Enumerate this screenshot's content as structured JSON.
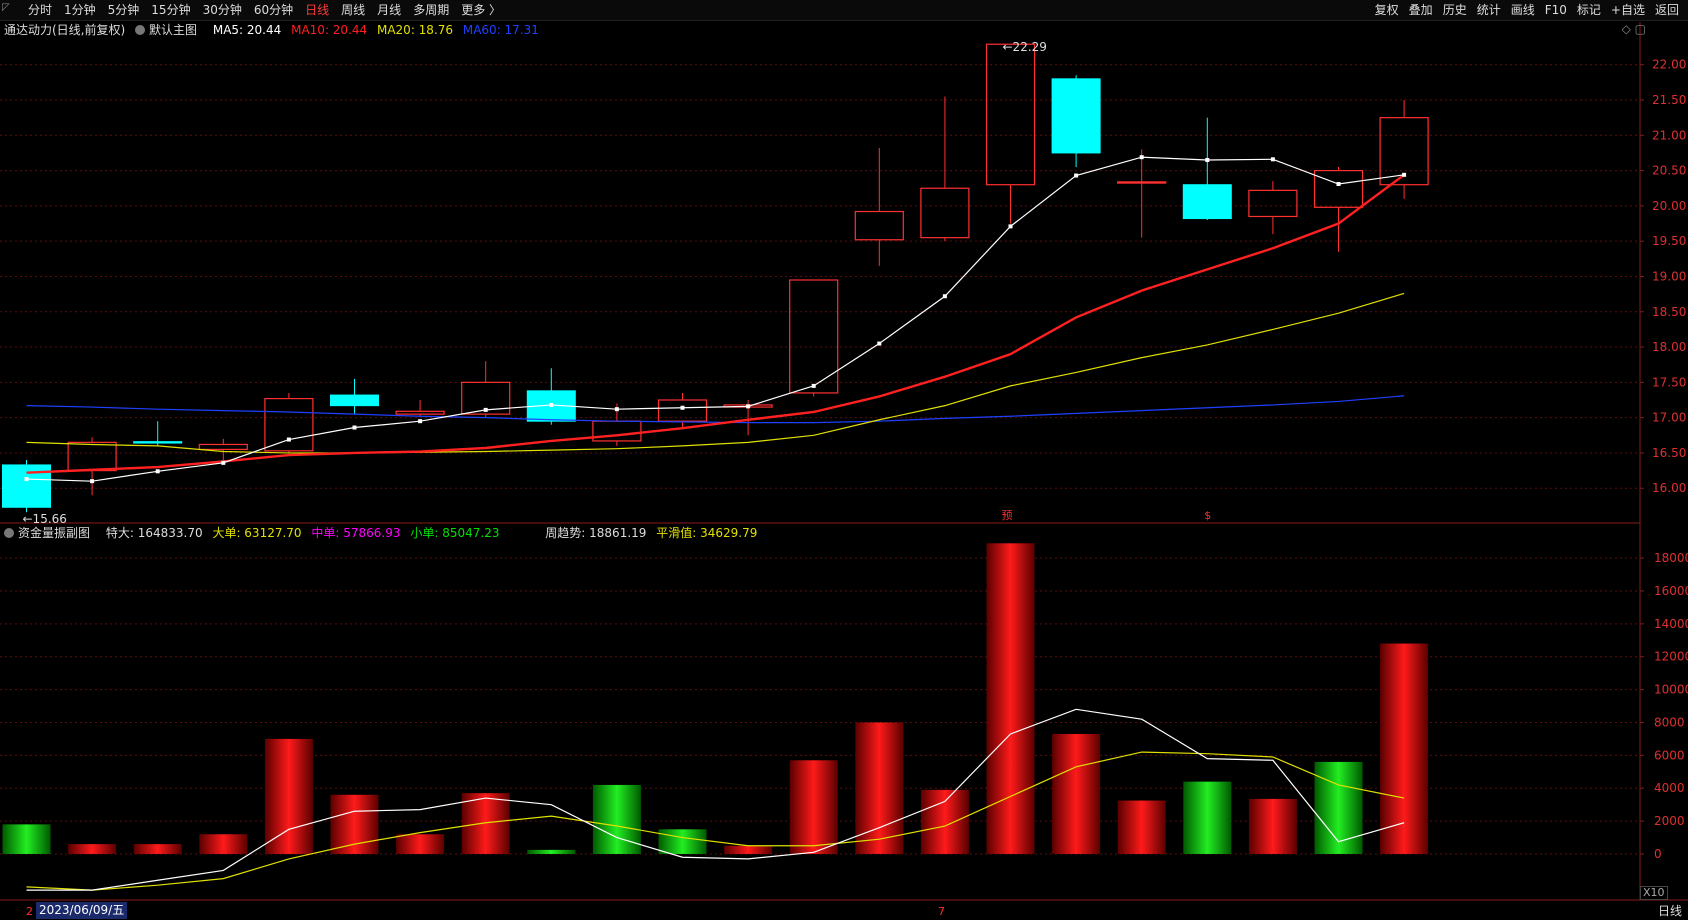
{
  "toolbar": {
    "periods": [
      "分时",
      "1分钟",
      "5分钟",
      "15分钟",
      "30分钟",
      "60分钟",
      "日线",
      "周线",
      "月线",
      "多周期",
      "更多 〉"
    ],
    "active_period": "日线",
    "tools": [
      "复权",
      "叠加",
      "历史",
      "统计",
      "画线",
      "F10",
      "标记",
      "+自选",
      "返回"
    ]
  },
  "main_legend": {
    "stock": "通达动力(日线,前复权)",
    "template": "默认主图",
    "ma5": "MA5: 20.44",
    "ma10": "MA10: 20.44",
    "ma20": "MA20: 18.76",
    "ma60": "MA60: 17.31"
  },
  "sub_legend": {
    "name": "资金量振副图",
    "super": "特大: 164833.70",
    "large": "大单: 63127.70",
    "mid": "中单: 57866.93",
    "small": "小单: 85047.23",
    "weekly": "周趋势: 18861.19",
    "smooth": "平滑值: 34629.79"
  },
  "colors": {
    "up": "#ff3030",
    "down": "#00ffff",
    "ma5": "#ffffff",
    "ma10": "#ff2020",
    "ma20": "#e0e000",
    "ma60": "#2040ff",
    "bar_up": "#cc0000",
    "bar_down": "#00b000"
  },
  "chart_data": [
    {
      "type": "candlestick",
      "y_ticks": [
        16.0,
        16.5,
        17.0,
        17.5,
        18.0,
        18.5,
        19.0,
        19.5,
        20.0,
        20.5,
        21.0,
        21.5,
        22.0
      ],
      "ylim": [
        15.55,
        22.35
      ],
      "annotations": {
        "high": "22.29",
        "low": "15.66",
        "marker1": "预",
        "marker2": "$"
      },
      "candles": [
        {
          "o": 16.33,
          "c": 15.73,
          "h": 16.4,
          "l": 15.66
        },
        {
          "o": 16.25,
          "c": 16.65,
          "h": 16.72,
          "l": 15.9
        },
        {
          "o": 16.66,
          "c": 16.64,
          "h": 16.95,
          "l": 16.6
        },
        {
          "o": 16.55,
          "c": 16.62,
          "h": 16.7,
          "l": 16.4
        },
        {
          "o": 16.53,
          "c": 17.27,
          "h": 17.35,
          "l": 16.5
        },
        {
          "o": 17.32,
          "c": 17.17,
          "h": 17.55,
          "l": 17.05
        },
        {
          "o": 17.05,
          "c": 17.09,
          "h": 17.25,
          "l": 17.02
        },
        {
          "o": 17.05,
          "c": 17.5,
          "h": 17.8,
          "l": 17.0
        },
        {
          "o": 17.38,
          "c": 16.95,
          "h": 17.7,
          "l": 16.9
        },
        {
          "o": 16.67,
          "c": 16.95,
          "h": 17.2,
          "l": 16.6
        },
        {
          "o": 16.95,
          "c": 17.25,
          "h": 17.35,
          "l": 16.85
        },
        {
          "o": 17.15,
          "c": 17.18,
          "h": 17.25,
          "l": 16.75
        },
        {
          "o": 17.35,
          "c": 18.95,
          "h": 18.95,
          "l": 17.3
        },
        {
          "o": 19.52,
          "c": 19.92,
          "h": 20.82,
          "l": 19.15
        },
        {
          "o": 19.55,
          "c": 20.25,
          "h": 21.55,
          "l": 19.5
        },
        {
          "o": 20.3,
          "c": 22.29,
          "h": 22.29,
          "l": 19.75
        },
        {
          "o": 21.8,
          "c": 20.75,
          "h": 21.85,
          "l": 20.55
        },
        {
          "o": 20.34,
          "c": 20.34,
          "h": 20.8,
          "l": 19.55
        },
        {
          "o": 20.3,
          "c": 19.82,
          "h": 21.25,
          "l": 19.8
        },
        {
          "o": 19.85,
          "c": 20.22,
          "h": 20.35,
          "l": 19.6
        },
        {
          "o": 19.98,
          "c": 20.5,
          "h": 20.55,
          "l": 19.35
        },
        {
          "o": 20.3,
          "c": 21.25,
          "h": 21.5,
          "l": 20.1
        }
      ],
      "ma5": [
        16.13,
        16.1,
        16.24,
        16.36,
        16.69,
        16.86,
        16.95,
        17.11,
        17.18,
        17.12,
        17.14,
        17.16,
        17.45,
        18.05,
        18.72,
        19.71,
        20.43,
        20.69,
        20.65,
        20.66,
        20.31,
        20.44
      ],
      "ma10": [
        16.22,
        16.26,
        16.3,
        16.38,
        16.47,
        16.5,
        16.52,
        16.57,
        16.67,
        16.75,
        16.85,
        16.97,
        17.08,
        17.3,
        17.58,
        17.9,
        18.42,
        18.8,
        19.1,
        19.4,
        19.75,
        20.44
      ],
      "ma20": [
        16.65,
        16.62,
        16.6,
        16.52,
        16.5,
        16.5,
        16.51,
        16.52,
        16.54,
        16.56,
        16.6,
        16.65,
        16.75,
        16.97,
        17.17,
        17.45,
        17.64,
        17.85,
        18.03,
        18.25,
        18.48,
        18.76
      ],
      "ma60": [
        17.17,
        17.15,
        17.12,
        17.1,
        17.08,
        17.05,
        17.02,
        17.0,
        16.97,
        16.95,
        16.94,
        16.93,
        16.93,
        16.95,
        16.99,
        17.02,
        17.06,
        17.1,
        17.14,
        17.18,
        17.23,
        17.31
      ]
    },
    {
      "type": "bar",
      "y_ticks": [
        0,
        2000,
        4000,
        6000,
        8000,
        10000,
        12000,
        14000,
        16000,
        18000
      ],
      "ylim": [
        -2800,
        19100
      ],
      "scale_label": "X10",
      "values": [
        1800,
        600,
        600,
        1200,
        7000,
        3600,
        1200,
        3700,
        250,
        4200,
        1500,
        500,
        5700,
        8000,
        3900,
        18900,
        7300,
        3250,
        4400,
        3350,
        5600,
        12800
      ],
      "direction": [
        "down",
        "up",
        "up",
        "up",
        "up",
        "up",
        "up",
        "up",
        "down",
        "down",
        "down",
        "up",
        "up",
        "up",
        "up",
        "up",
        "up",
        "up",
        "down",
        "up",
        "down",
        "up"
      ],
      "line_white": [
        -2200,
        -2200,
        -1600,
        -1000,
        1500,
        2600,
        2700,
        3400,
        3000,
        1000,
        -200,
        -300,
        100,
        1600,
        3200,
        7300,
        8800,
        8200,
        5800,
        5700,
        750,
        1900
      ],
      "line_yellow": [
        -2000,
        -2200,
        -1900,
        -1500,
        -300,
        600,
        1300,
        1900,
        2300,
        1700,
        1000,
        500,
        500,
        900,
        1700,
        3500,
        5300,
        6200,
        6100,
        5900,
        4200,
        3400
      ]
    }
  ],
  "bottom": {
    "date": "2023/06/09/五",
    "period": "日线",
    "tick_left": "2",
    "tick_mid": "7"
  }
}
